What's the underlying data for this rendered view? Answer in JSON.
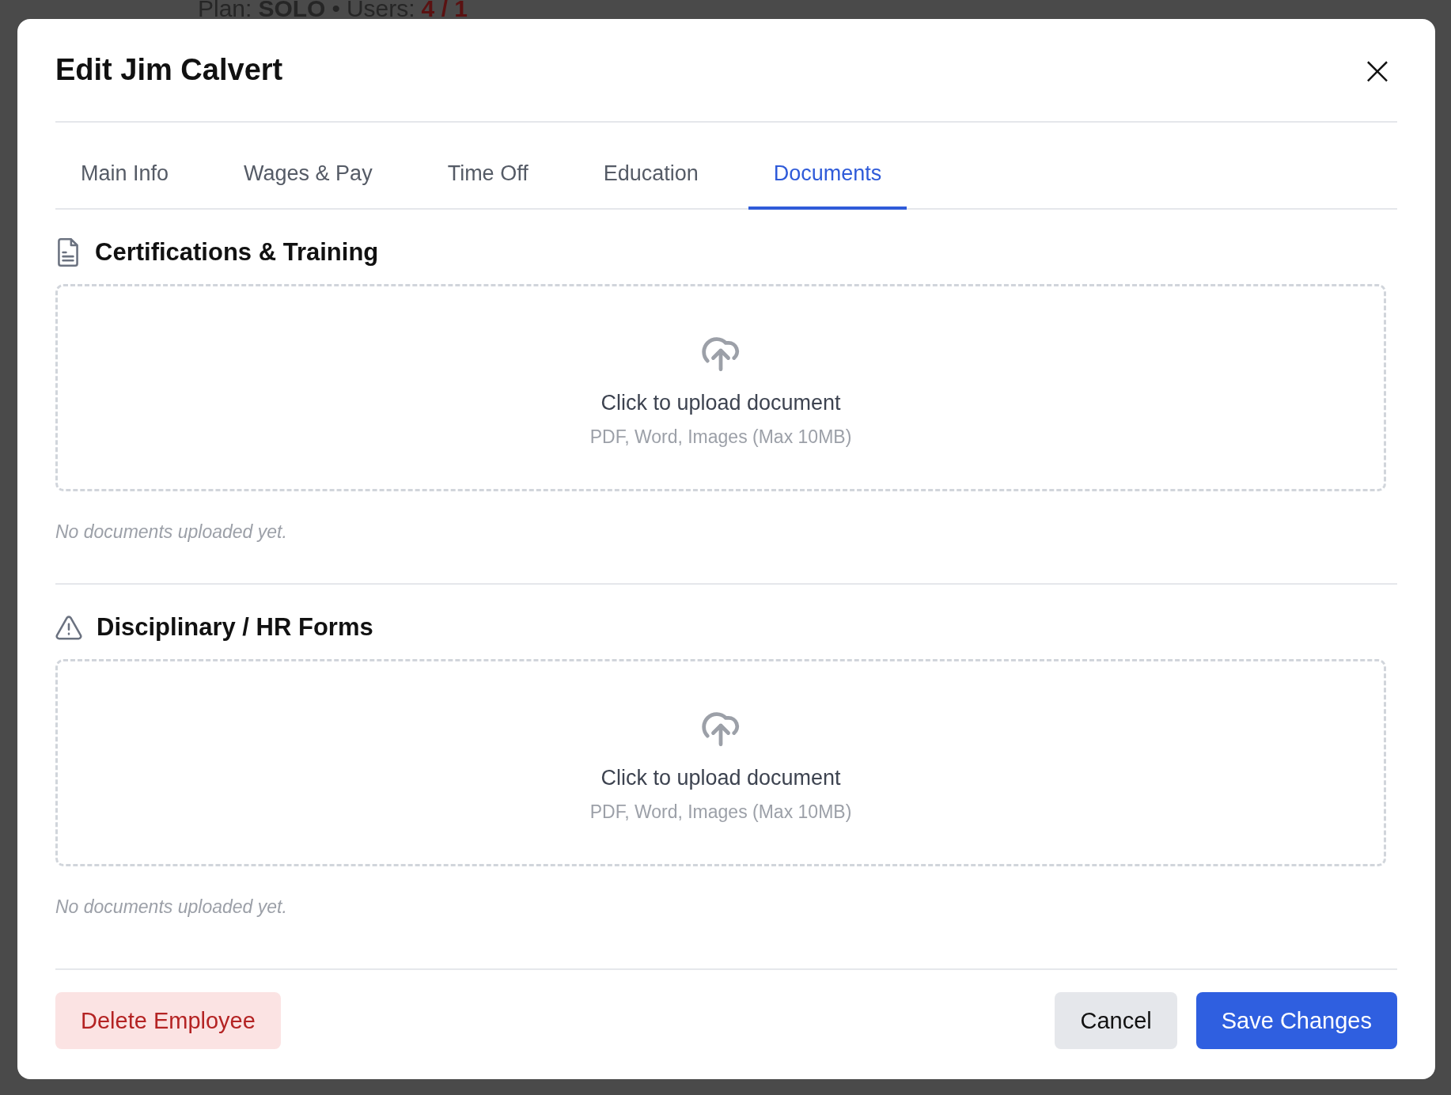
{
  "background": {
    "plan_label": "Plan:",
    "plan": "SOLO",
    "separator": "•",
    "users_label": "Users:",
    "users": "4 / 1"
  },
  "dialog": {
    "title": "Edit Jim Calvert",
    "close": "×",
    "tabs": [
      {
        "label": "Main Info",
        "selected": false
      },
      {
        "label": "Wages & Pay",
        "selected": false
      },
      {
        "label": "Time Off",
        "selected": false
      },
      {
        "label": "Education",
        "selected": false
      },
      {
        "label": "Documents",
        "selected": true
      }
    ],
    "sections": [
      {
        "kind": "document",
        "title": "Certifications & Training",
        "upload": "Click to upload document",
        "hint": "PDF, Word, Images (Max 10MB)",
        "empty": "No documents uploaded yet."
      },
      {
        "kind": "warning",
        "title": "Disciplinary / HR Forms",
        "upload": "Click to upload document",
        "hint": "PDF, Word, Images (Max 10MB)",
        "empty": "No documents uploaded yet."
      }
    ],
    "buttons": [
      {
        "kind": "danger",
        "label": "Delete Employee"
      },
      {
        "kind": "secondary",
        "label": "Cancel"
      },
      {
        "kind": "primary",
        "label": "Save Changes"
      }
    ]
  }
}
